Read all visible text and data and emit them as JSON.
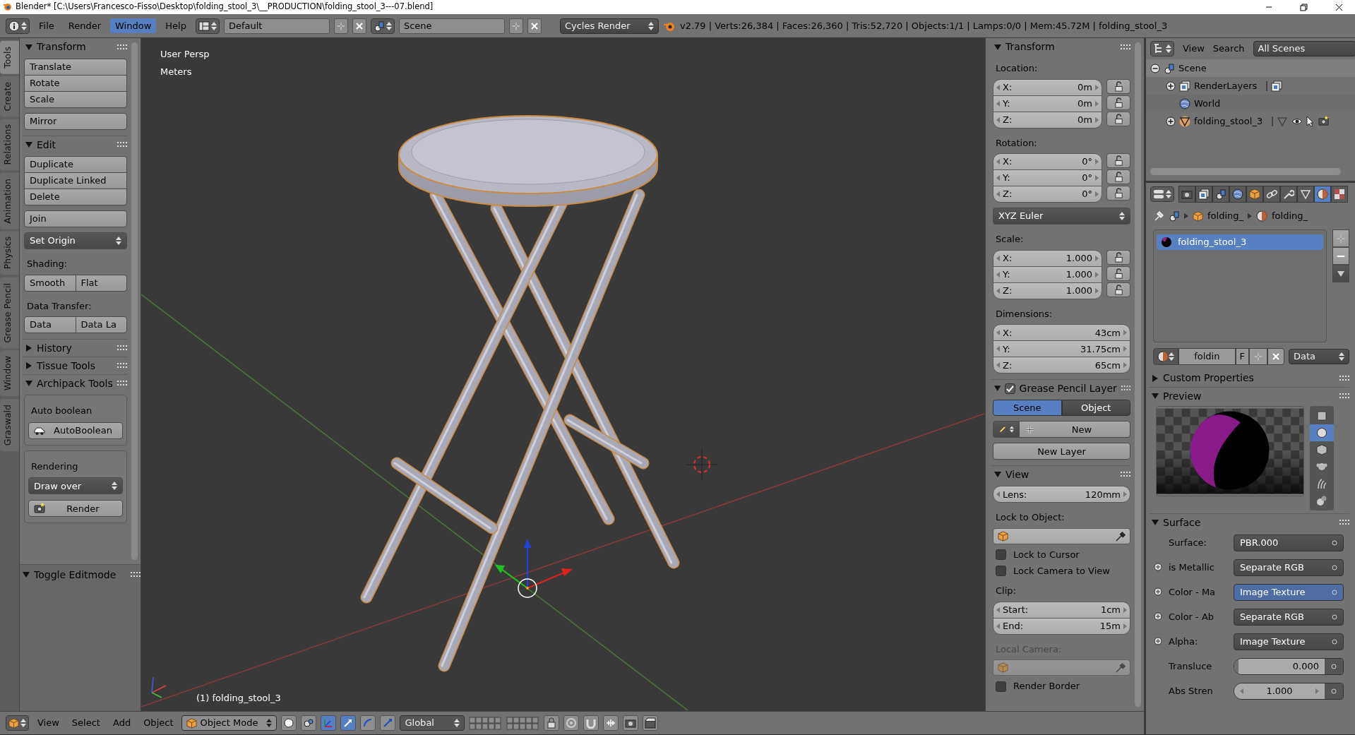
{
  "title_bar": {
    "title": "Blender* [C:\\Users\\Francesco-Fisso\\Desktop\\folding_stool_3\\__PRODUCTION\\folding_stool_3---07.blend]"
  },
  "menu_bar": {
    "menus": [
      {
        "label": "File",
        "selected": false
      },
      {
        "label": "Render",
        "selected": false
      },
      {
        "label": "Window",
        "selected": true
      },
      {
        "label": "Help",
        "selected": false
      }
    ],
    "screen_layout": "Default",
    "scene": "Scene",
    "render_engine": "Cycles Render",
    "stats": "v2.79 | Verts:26,384 | Faces:26,360 | Tris:52,720 | Objects:1/1 | Lamps:0/0 | Mem:45.72M | folding_stool_3"
  },
  "tool_shelf": {
    "tabs": [
      {
        "label": "Tools",
        "selected": true
      },
      {
        "label": "Create",
        "selected": false
      },
      {
        "label": "Relations",
        "selected": false
      },
      {
        "label": "Animation",
        "selected": false
      },
      {
        "label": "Physics",
        "selected": false
      },
      {
        "label": "Grease Pencil",
        "selected": false
      },
      {
        "label": "Window",
        "selected": false
      },
      {
        "label": "Graswald",
        "selected": false
      }
    ],
    "panels": [
      {
        "title": "Transform",
        "expanded": true,
        "items": [
          {
            "kind": "stack",
            "buttons": [
              "Translate",
              "Rotate",
              "Scale"
            ]
          },
          {
            "kind": "stack",
            "buttons": [
              "Mirror"
            ]
          }
        ]
      },
      {
        "title": "Edit",
        "expanded": true,
        "items": [
          {
            "kind": "stack",
            "buttons": [
              "Duplicate",
              "Duplicate Linked",
              "Delete"
            ]
          },
          {
            "kind": "stack",
            "buttons": [
              "Join"
            ]
          },
          {
            "kind": "select",
            "label": "Set Origin"
          },
          {
            "kind": "label",
            "text": "Shading:"
          },
          {
            "kind": "row",
            "buttons": [
              "Smooth",
              "Flat"
            ]
          },
          {
            "kind": "label",
            "text": "Data Transfer:"
          },
          {
            "kind": "row",
            "buttons": [
              "Data",
              "Data La"
            ]
          }
        ]
      },
      {
        "title": "History",
        "expanded": false
      },
      {
        "title": "Tissue Tools",
        "expanded": false
      },
      {
        "title": "Archipack Tools",
        "expanded": true,
        "items": [
          {
            "kind": "box",
            "items": [
              {
                "kind": "label",
                "text": "Auto boolean"
              },
              {
                "kind": "boolean_button",
                "label": "AutoBoolean"
              }
            ]
          },
          {
            "kind": "box",
            "items": [
              {
                "kind": "label",
                "text": "Rendering"
              },
              {
                "kind": "select",
                "label": "Draw over"
              },
              {
                "kind": "render_button",
                "label": "Render"
              }
            ]
          }
        ]
      }
    ],
    "last_operator": {
      "title": "Toggle Editmode",
      "expanded": true
    }
  },
  "viewport": {
    "view_name": "User Persp",
    "units": "Meters",
    "active_object": "(1) folding_stool_3"
  },
  "n_panel": {
    "panels": [
      {
        "title": "Transform",
        "expanded": true,
        "items": [
          {
            "kind": "label",
            "text": "Location:"
          },
          {
            "kind": "vector",
            "locks": true,
            "fields": [
              {
                "axis": "X:",
                "value": "0m"
              },
              {
                "axis": "Y:",
                "value": "0m"
              },
              {
                "axis": "Z:",
                "value": "0m"
              }
            ]
          },
          {
            "kind": "label",
            "text": "Rotation:"
          },
          {
            "kind": "vector",
            "locks": true,
            "fields": [
              {
                "axis": "X:",
                "value": "0°"
              },
              {
                "axis": "Y:",
                "value": "0°"
              },
              {
                "axis": "Z:",
                "value": "0°"
              }
            ]
          },
          {
            "kind": "select",
            "label": "XYZ Euler"
          },
          {
            "kind": "label",
            "text": "Scale:"
          },
          {
            "kind": "vector",
            "locks": true,
            "fields": [
              {
                "axis": "X:",
                "value": "1.000"
              },
              {
                "axis": "Y:",
                "value": "1.000"
              },
              {
                "axis": "Z:",
                "value": "1.000"
              }
            ]
          },
          {
            "kind": "label",
            "text": "Dimensions:"
          },
          {
            "kind": "vector",
            "locks": false,
            "fields": [
              {
                "axis": "X:",
                "value": "43cm"
              },
              {
                "axis": "Y:",
                "value": "31.75cm"
              },
              {
                "axis": "Z:",
                "value": "65cm"
              }
            ]
          }
        ]
      },
      {
        "title": "Grease Pencil Layer",
        "expanded": true,
        "checked": true,
        "items": [
          {
            "kind": "segmented",
            "options": [
              {
                "label": "Scene",
                "selected": true
              },
              {
                "label": "Object",
                "selected": false
              }
            ]
          },
          {
            "kind": "new_row",
            "label": "New"
          },
          {
            "kind": "button",
            "label": "New Layer"
          }
        ]
      },
      {
        "title": "View",
        "expanded": true,
        "items": [
          {
            "kind": "vector",
            "locks": false,
            "fields": [
              {
                "axis": "Lens:",
                "value": "120mm"
              }
            ]
          },
          {
            "kind": "label",
            "text": "Lock to Object:"
          },
          {
            "kind": "object_field",
            "disabled": false
          },
          {
            "kind": "checkbox",
            "label": "Lock to Cursor",
            "checked": false
          },
          {
            "kind": "checkbox",
            "label": "Lock Camera to View",
            "checked": false
          },
          {
            "kind": "label",
            "text": "Clip:"
          },
          {
            "kind": "vector",
            "locks": false,
            "fields": [
              {
                "axis": "Start:",
                "value": "1cm"
              },
              {
                "axis": "End:",
                "value": "15m"
              }
            ]
          },
          {
            "kind": "label",
            "text": "Local Camera:",
            "disabled": true
          },
          {
            "kind": "object_field",
            "disabled": true
          },
          {
            "kind": "checkbox",
            "label": "Render Border",
            "checked": false
          }
        ]
      }
    ]
  },
  "outliner": {
    "menus": [
      "View",
      "Search"
    ],
    "filter": "All Scenes",
    "tree": [
      {
        "kind": "scene",
        "label": "Scene",
        "expanded": true,
        "children": [
          {
            "kind": "renderlayers",
            "label": "RenderLayers",
            "expanded": false
          },
          {
            "kind": "world",
            "label": "World"
          },
          {
            "kind": "mesh",
            "label": "folding_stool_3",
            "expanded": false
          }
        ]
      }
    ]
  },
  "properties": {
    "tabs": [
      {
        "kind": "render",
        "selected": false
      },
      {
        "kind": "layers",
        "selected": false
      },
      {
        "kind": "scene",
        "selected": false
      },
      {
        "kind": "world",
        "selected": false
      },
      {
        "kind": "object",
        "selected": false
      },
      {
        "kind": "constraints",
        "selected": false
      },
      {
        "kind": "modifiers",
        "selected": false
      },
      {
        "kind": "data",
        "selected": false
      },
      {
        "kind": "material",
        "selected": true
      },
      {
        "kind": "texture",
        "selected": false
      }
    ],
    "breadcrumb": [
      "folding_",
      "folding_"
    ],
    "slots": [
      {
        "label": "folding_stool_3",
        "selected": true
      }
    ],
    "datablock": {
      "name": "foldin",
      "fake_user": "F",
      "link": "Data"
    },
    "panels": [
      {
        "title": "Custom Properties",
        "expanded": false
      },
      {
        "title": "Preview",
        "expanded": true,
        "preview_types": [
          {
            "kind": "plane",
            "selected": false
          },
          {
            "kind": "sphere",
            "selected": true
          },
          {
            "kind": "cube",
            "selected": false
          },
          {
            "kind": "monkey",
            "selected": false
          },
          {
            "kind": "hair",
            "selected": false
          },
          {
            "kind": "sky",
            "selected": false
          }
        ]
      },
      {
        "title": "Surface",
        "expanded": true,
        "inputs": [
          {
            "kind": "node",
            "label": "Surface:",
            "value": "PBR.000",
            "socket": false,
            "selected": false
          },
          {
            "kind": "node",
            "label": "is Metallic",
            "value": "Separate RGB",
            "socket": true,
            "selected": false
          },
          {
            "kind": "node",
            "label": "Color - Ma",
            "value": "Image Texture",
            "socket": true,
            "selected": true
          },
          {
            "kind": "node",
            "label": "Color - Ab",
            "value": "Separate RGB",
            "socket": true,
            "selected": false
          },
          {
            "kind": "node",
            "label": "Alpha:",
            "value": "Image Texture",
            "socket": true,
            "selected": false
          },
          {
            "kind": "slider",
            "label": "Transluce",
            "value": "0.000",
            "level": 0.05
          },
          {
            "kind": "number",
            "label": "Abs Stren",
            "value": "1.000"
          }
        ]
      }
    ]
  },
  "bottom_header": {
    "menus": [
      "View",
      "Select",
      "Add",
      "Object"
    ],
    "mode": "Object Mode",
    "orientation": "Global",
    "tools": [
      {
        "kind": "shading",
        "selected": false
      },
      {
        "kind": "pivot",
        "selected": false
      },
      {
        "kind": "manipulator",
        "selected": true
      },
      {
        "kind": "translate",
        "selected": true
      },
      {
        "kind": "rotate",
        "selected": false
      },
      {
        "kind": "scale",
        "selected": false
      }
    ],
    "extras": [
      {
        "kind": "lock"
      },
      {
        "kind": "proportional"
      },
      {
        "kind": "snap"
      },
      {
        "kind": "snap_target"
      },
      {
        "kind": "render_preview"
      },
      {
        "kind": "render_anim"
      }
    ]
  }
}
